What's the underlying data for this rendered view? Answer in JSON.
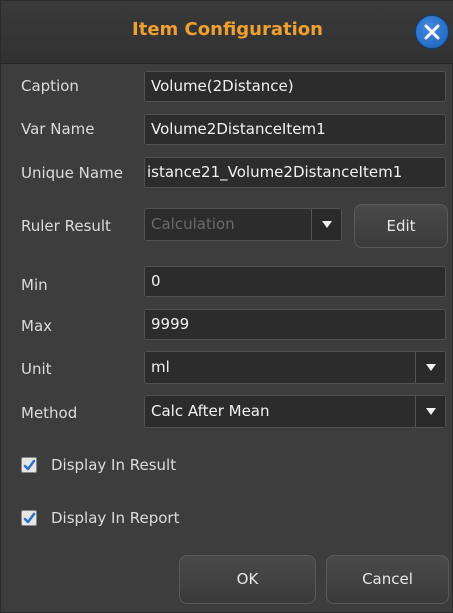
{
  "dialog": {
    "title": "Item Configuration",
    "close_icon": "close-icon",
    "accent_color": "#f0a030"
  },
  "fields": {
    "caption": {
      "label": "Caption",
      "value": "Volume(2Distance)"
    },
    "var_name": {
      "label": "Var Name",
      "value": "Volume2DistanceItem1"
    },
    "unique_name": {
      "label": "Unique Name",
      "value": "istance21_Volume2DistanceItem1"
    },
    "ruler_result": {
      "label": "Ruler Result",
      "value": "Calculation",
      "edit_label": "Edit"
    },
    "min": {
      "label": "Min",
      "value": "0"
    },
    "max": {
      "label": "Max",
      "value": "9999"
    },
    "unit": {
      "label": "Unit",
      "value": "ml"
    },
    "method": {
      "label": "Method",
      "value": "Calc After Mean"
    }
  },
  "checkboxes": {
    "display_in_result": {
      "label": "Display In Result",
      "checked": true
    },
    "display_in_report": {
      "label": "Display In Report",
      "checked": true
    }
  },
  "buttons": {
    "ok": "OK",
    "cancel": "Cancel"
  }
}
